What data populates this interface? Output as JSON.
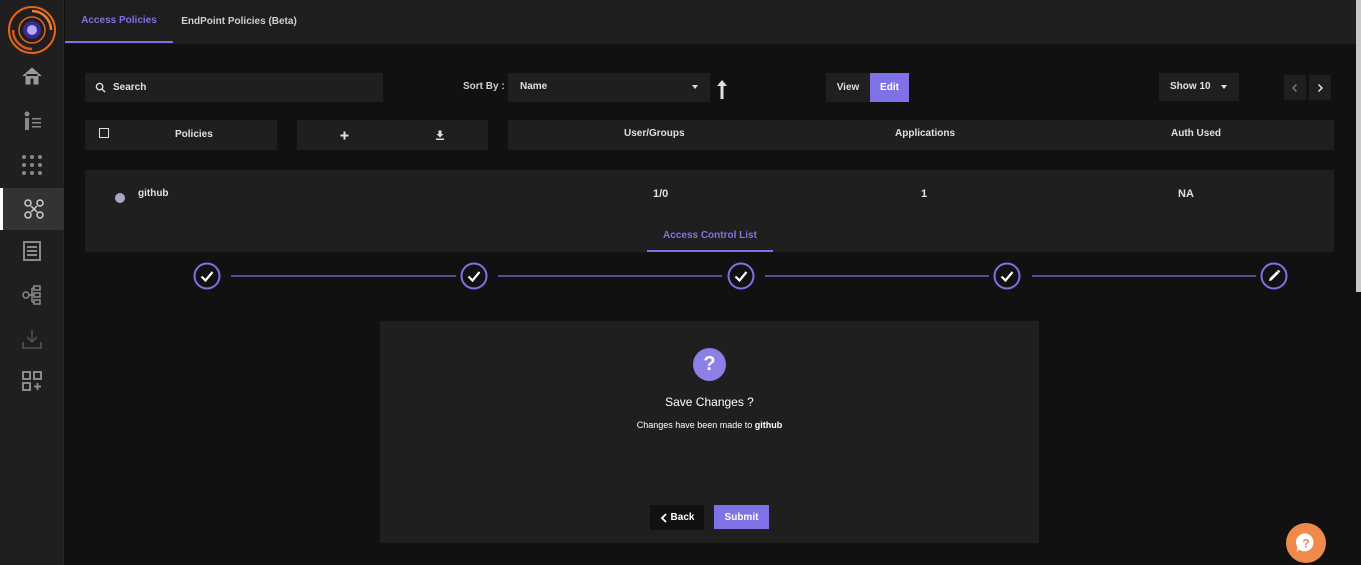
{
  "colors": {
    "accent": "#7f72e6",
    "background": "#111111",
    "panel": "#1f1f1f",
    "help": "#f08a4b"
  },
  "tabs": [
    {
      "label": "Access Policies",
      "active": true
    },
    {
      "label": "EndPoint Policies (Beta)",
      "active": false
    }
  ],
  "sidebar": {
    "items": [
      {
        "icon": "home-icon"
      },
      {
        "icon": "user-list-icon"
      },
      {
        "icon": "grid-dots-icon"
      },
      {
        "icon": "access-policy-icon",
        "active": true
      },
      {
        "icon": "document-list-icon"
      },
      {
        "icon": "network-tree-icon"
      },
      {
        "icon": "download-icon"
      },
      {
        "icon": "add-app-icon"
      }
    ]
  },
  "toolbar": {
    "search_placeholder": "Search",
    "sort_label": "Sort By :",
    "sort_value": "Name",
    "view_label": "View",
    "edit_label": "Edit",
    "show_value": "Show 10"
  },
  "table": {
    "headers": {
      "policies": "Policies",
      "user_groups": "User/Groups",
      "applications": "Applications",
      "auth_used": "Auth Used"
    },
    "rows": [
      {
        "name": "github",
        "user_groups": "1/0",
        "applications": "1",
        "auth_used": "NA"
      }
    ]
  },
  "acl_tab_label": "Access Control List",
  "steps": [
    {
      "state": "done"
    },
    {
      "state": "done"
    },
    {
      "state": "done"
    },
    {
      "state": "done"
    },
    {
      "state": "edit"
    }
  ],
  "dialog": {
    "title": "Save Changes ?",
    "message_prefix": "Changes have been made to ",
    "message_target": "github",
    "back_label": "Back",
    "submit_label": "Submit"
  }
}
